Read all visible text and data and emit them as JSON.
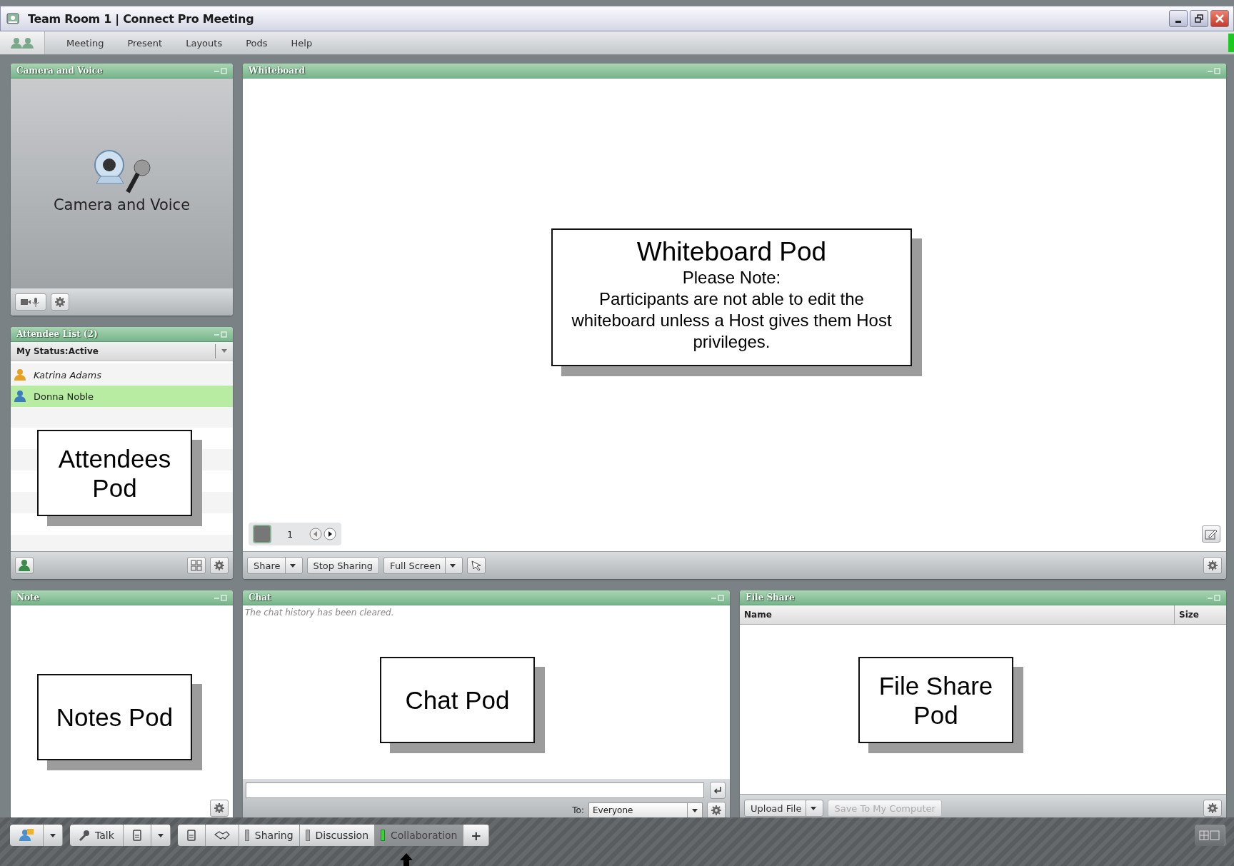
{
  "window": {
    "title": "Team Room 1 | Connect Pro Meeting"
  },
  "menu": [
    "Meeting",
    "Present",
    "Layouts",
    "Pods",
    "Help"
  ],
  "camera_pod": {
    "title": "Camera and Voice",
    "label": "Camera and Voice"
  },
  "attendee_pod": {
    "title": "Attendee List (2)",
    "status": "My Status:Active",
    "attendees": [
      {
        "name": "Katrina Adams",
        "kind": "host",
        "selected": false
      },
      {
        "name": "Donna Noble",
        "kind": "participant",
        "selected": true
      }
    ],
    "callout": "Attendees Pod"
  },
  "whiteboard_pod": {
    "title": "Whiteboard",
    "page": "1",
    "callout": {
      "heading": "Whiteboard Pod",
      "note": "Please Note:",
      "text": "Participants are not able to edit the whiteboard unless a Host gives them Host privileges."
    },
    "buttons": [
      {
        "label": "Share",
        "dropdown": true
      },
      {
        "label": "Stop Sharing",
        "dropdown": false
      },
      {
        "label": "Full Screen",
        "dropdown": true
      }
    ]
  },
  "note_pod": {
    "title": "Note",
    "callout": "Notes Pod"
  },
  "chat_pod": {
    "title": "Chat",
    "message": "The chat history has been cleared.",
    "to_label": "To:",
    "recipient": "Everyone",
    "callout": "Chat Pod"
  },
  "file_share_pod": {
    "title": "File Share",
    "columns": [
      "Name",
      "Size"
    ],
    "buttons": [
      {
        "label": "Upload File",
        "dropdown": true,
        "disabled": false
      },
      {
        "label": "Save To My Computer",
        "dropdown": false,
        "disabled": true
      }
    ],
    "callout": "File Share Pod"
  },
  "taskbar": {
    "talk": "Talk",
    "layouts": [
      {
        "label": "Sharing",
        "selected": false
      },
      {
        "label": "Discussion",
        "selected": false
      },
      {
        "label": "Collaboration",
        "selected": true
      }
    ],
    "add": "+"
  }
}
